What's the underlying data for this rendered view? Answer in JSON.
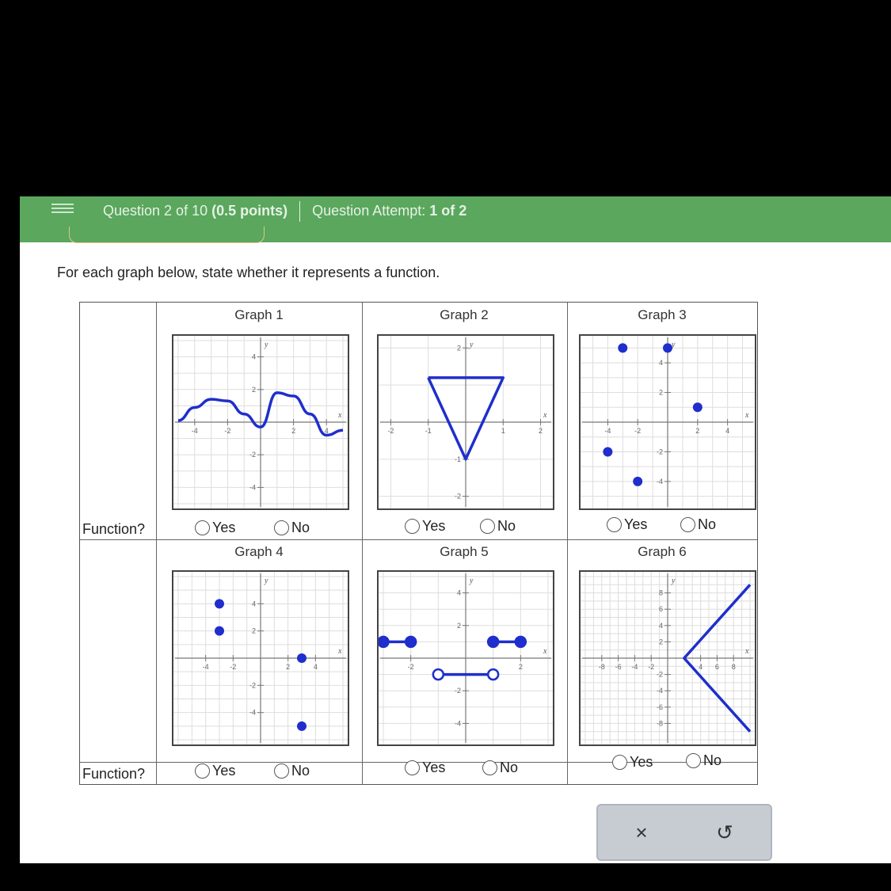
{
  "header": {
    "question_label": "Question 2 of 10",
    "points": "(0.5 points)",
    "attempt_label": "Question Attempt:",
    "attempt_value": "1 of 2"
  },
  "prompt": "For each graph below, state whether it represents a function.",
  "row_label": "Function?",
  "options": {
    "yes": "Yes",
    "no": "No"
  },
  "graphs": [
    {
      "title": "Graph 1"
    },
    {
      "title": "Graph 2"
    },
    {
      "title": "Graph 3"
    },
    {
      "title": "Graph 4"
    },
    {
      "title": "Graph 5"
    },
    {
      "title": "Graph 6"
    }
  ],
  "actions": {
    "clear": "×",
    "undo": "↺"
  },
  "colors": {
    "topbar": "#5aa75d",
    "plot_blue": "#1f2ecc"
  },
  "chart_data": [
    {
      "type": "line",
      "title": "Graph 1",
      "xlabel": "x",
      "ylabel": "y",
      "xlim": [
        -5,
        5
      ],
      "ylim": [
        -5,
        5
      ],
      "xticks": [
        -4,
        -2,
        2,
        4
      ],
      "yticks": [
        4,
        2,
        -2,
        -4
      ],
      "series": [
        {
          "x": [
            -5,
            -4,
            -3,
            -2,
            -1,
            0,
            1,
            2,
            3,
            4,
            5
          ],
          "y": [
            0.1,
            0.9,
            1.4,
            1.3,
            0.5,
            -0.3,
            1.8,
            1.6,
            0.5,
            -0.8,
            -0.5
          ]
        }
      ]
    },
    {
      "type": "line",
      "title": "Graph 2",
      "xlabel": "x",
      "ylabel": "y",
      "xlim": [
        -2.2,
        2.2
      ],
      "ylim": [
        -2.2,
        2.2
      ],
      "xticks": [
        -2,
        -1,
        1,
        2
      ],
      "yticks": [
        2,
        -1,
        -2
      ],
      "series": [
        {
          "x": [
            -1,
            1,
            0,
            -1
          ],
          "y": [
            1.2,
            1.2,
            -1,
            1.2
          ]
        }
      ]
    },
    {
      "type": "scatter",
      "title": "Graph 3",
      "xlabel": "x",
      "ylabel": "y",
      "xlim": [
        -5.5,
        5.5
      ],
      "ylim": [
        -5.5,
        5.5
      ],
      "xticks": [
        -4,
        -2,
        2,
        4
      ],
      "yticks": [
        4,
        2,
        -2,
        -4
      ],
      "series": [
        {
          "x": [
            -3,
            0,
            2,
            -4,
            -2
          ],
          "y": [
            5,
            5,
            1,
            -2,
            -4
          ]
        }
      ]
    },
    {
      "type": "scatter",
      "title": "Graph 4",
      "xlabel": "x",
      "ylabel": "y",
      "xlim": [
        -6,
        6
      ],
      "ylim": [
        -6,
        6
      ],
      "xticks": [
        -4,
        -2,
        2,
        4
      ],
      "yticks": [
        4,
        2,
        -2,
        -4
      ],
      "series": [
        {
          "x": [
            -3,
            -3,
            3,
            3
          ],
          "y": [
            4,
            2,
            0,
            -5
          ]
        }
      ]
    },
    {
      "type": "line",
      "title": "Graph 5",
      "xlabel": "x",
      "ylabel": "y",
      "xlim": [
        -3,
        3
      ],
      "ylim": [
        -5,
        5
      ],
      "xticks": [
        -2,
        2
      ],
      "yticks": [
        4,
        2,
        -2,
        -4
      ],
      "segments": [
        {
          "x": [
            -3,
            -2
          ],
          "y": [
            1,
            1
          ],
          "closed": [
            true,
            true
          ]
        },
        {
          "x": [
            1,
            2
          ],
          "y": [
            1,
            1
          ],
          "closed": [
            true,
            true
          ]
        },
        {
          "x": [
            -1,
            1
          ],
          "y": [
            -1,
            -1
          ],
          "closed": [
            false,
            false
          ]
        }
      ]
    },
    {
      "type": "line",
      "title": "Graph 6",
      "xlabel": "x",
      "ylabel": "y",
      "xlim": [
        -10,
        10
      ],
      "ylim": [
        -10,
        10
      ],
      "xticks": [
        -8,
        -6,
        -4,
        -2,
        4,
        6,
        8
      ],
      "yticks": [
        8,
        6,
        4,
        2,
        -2,
        -4,
        -6,
        -8
      ],
      "series": [
        {
          "x": [
            10,
            2,
            10
          ],
          "y": [
            9,
            0,
            -9
          ]
        }
      ]
    }
  ]
}
